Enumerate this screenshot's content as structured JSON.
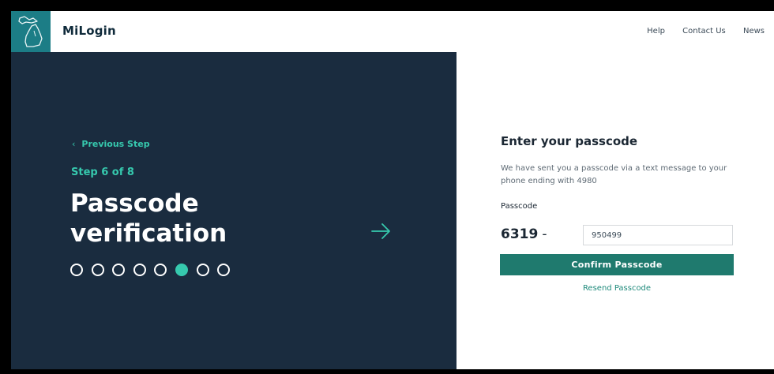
{
  "header": {
    "brand": "MiLogin",
    "nav": [
      "Help",
      "Contact Us",
      "News"
    ]
  },
  "left": {
    "previous_step": "Previous Step",
    "step_label": "Step 6 of 8",
    "title_line1": "Passcode",
    "title_line2": "verification",
    "progress": {
      "total_steps": 8,
      "current_step": 6
    }
  },
  "form": {
    "title": "Enter your passcode",
    "description": "We have sent you a passcode via a text message to your phone ending with 4980",
    "passcode_label": "Passcode",
    "passcode_prefix": "6319",
    "prefix_separator": "-",
    "passcode_value": "950499",
    "confirm_label": "Confirm Passcode",
    "resend_label": "Resend Passcode"
  },
  "colors": {
    "accent": "#36c9ae",
    "panel_dark": "#1a2c3f",
    "button": "#1f7a6e",
    "logo_bg": "#1c7d86"
  },
  "icons": {
    "logo": "michigan-state-icon",
    "back": "chevron-left-icon",
    "next": "arrow-right-icon"
  }
}
